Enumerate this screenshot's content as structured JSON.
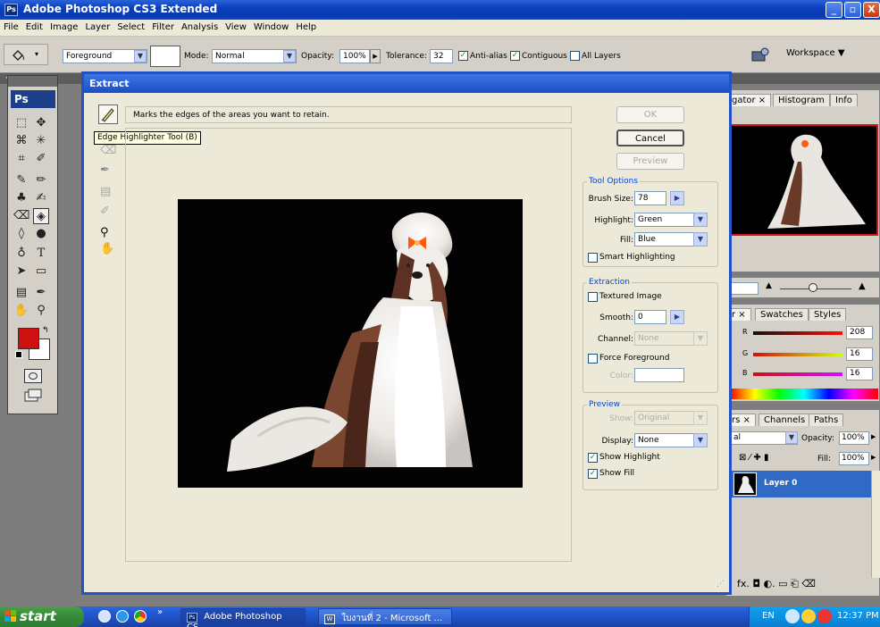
{
  "app": {
    "title": "Adobe Photoshop CS3 Extended",
    "logo": "Ps",
    "minimize": "_",
    "maximize": "▫",
    "close": "X"
  },
  "menu": [
    "File",
    "Edit",
    "Image",
    "Layer",
    "Select",
    "Filter",
    "Analysis",
    "View",
    "Window",
    "Help"
  ],
  "options_bar": {
    "fill_source": "Foreground",
    "mode_label": "Mode:",
    "mode_value": "Normal",
    "opacity_label": "Opacity:",
    "opacity_value": "100%",
    "tolerance_label": "Tolerance:",
    "tolerance_value": "32",
    "anti_alias": "Anti-alias",
    "contiguous": "Contiguous",
    "all_layers": "All Layers",
    "workspace": "Workspace ▼"
  },
  "toolbox": {
    "logo": "Ps",
    "collapse": "◂◂"
  },
  "dialog": {
    "title": "Extract",
    "hint": "Marks the edges of the areas you want to retain.",
    "tooltip": "Edge Highlighter Tool (B)",
    "ok": "OK",
    "cancel": "Cancel",
    "preview": "Preview",
    "tool_options": {
      "title": "Tool Options",
      "brush_size_label": "Brush Size:",
      "brush_size_value": "78",
      "highlight_label": "Highlight:",
      "highlight_value": "Green",
      "fill_label": "Fill:",
      "fill_value": "Blue",
      "smart_highlighting": "Smart Highlighting"
    },
    "extraction": {
      "title": "Extraction",
      "textured_image": "Textured Image",
      "smooth_label": "Smooth:",
      "smooth_value": "0",
      "channel_label": "Channel:",
      "channel_value": "None",
      "force_foreground": "Force Foreground",
      "color_label": "Color:"
    },
    "preview_group": {
      "title": "Preview",
      "show_label": "Show:",
      "show_value": "Original",
      "display_label": "Display:",
      "display_value": "None",
      "show_highlight": "Show Highlight",
      "show_fill": "Show Fill"
    }
  },
  "panels": {
    "navigator_tabs": [
      "gator ×",
      "Histogram",
      "Info"
    ],
    "color_tabs": [
      "r ×",
      "Swatches",
      "Styles"
    ],
    "color": {
      "r_label": "R",
      "r_value": "208",
      "g_label": "G",
      "g_value": "16",
      "b_label": "B",
      "b_value": "16"
    },
    "layers_tabs": [
      "rs ×",
      "Channels",
      "Paths"
    ],
    "blend_mode": "al",
    "opacity_label": "Opacity:",
    "opacity_value": "100%",
    "fill_label": "Fill:",
    "fill_value": "100%",
    "layer_name": "Layer 0"
  },
  "taskbar": {
    "start": "start",
    "items": [
      "Adobe Photoshop CS...",
      "ใบงานที่ 2 - Microsoft ..."
    ],
    "items_icons": [
      "Ps",
      "W"
    ],
    "language": "EN",
    "clock": "12:37 PM"
  },
  "colors": {
    "foreground": "#d01010",
    "background": "#ffffff",
    "titlebar": "#0b3fbd",
    "dialog_bg": "#ece9d8"
  }
}
